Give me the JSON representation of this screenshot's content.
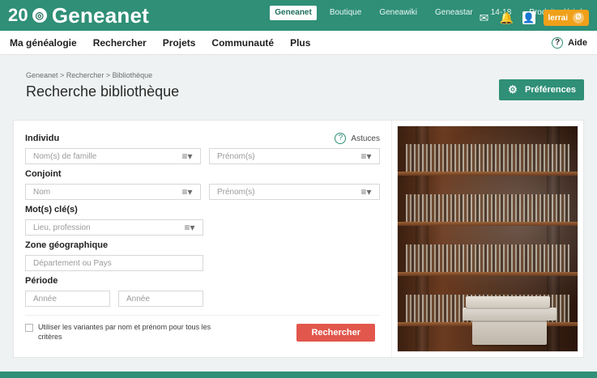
{
  "top": {
    "brand": {
      "prefix": "20",
      "name": "Geneanet"
    },
    "links": [
      {
        "label": "Geneanet",
        "active": true
      },
      {
        "label": "Boutique",
        "active": false
      },
      {
        "label": "Geneawiki",
        "active": false
      },
      {
        "label": "Geneastar",
        "active": false
      },
      {
        "label": "14-18",
        "active": false
      },
      {
        "label": "Produits dérivés",
        "active": false
      }
    ],
    "user": {
      "name": "lerrai",
      "badge": "Ø"
    }
  },
  "nav": {
    "items": [
      "Ma généalogie",
      "Rechercher",
      "Projets",
      "Communauté",
      "Plus"
    ],
    "help_label": "Aide"
  },
  "page": {
    "breadcrumb": "Geneanet > Rechercher > Bibliothèque",
    "title": "Recherche bibliothèque",
    "preferences_label": "Préférences"
  },
  "form": {
    "individu": {
      "label": "Individu",
      "astuces_label": "Astuces",
      "nom_placeholder": "Nom(s) de famille",
      "prenom_placeholder": "Prénom(s)"
    },
    "conjoint": {
      "label": "Conjoint",
      "nom_placeholder": "Nom",
      "prenom_placeholder": "Prénom(s)"
    },
    "mots_cles": {
      "label": "Mot(s) clé(s)",
      "placeholder": "Lieu, profession"
    },
    "zone": {
      "label": "Zone géographique",
      "placeholder": "Département ou Pays"
    },
    "periode": {
      "label": "Période",
      "annee1_placeholder": "Année",
      "annee2_placeholder": "Année"
    },
    "checkbox_label": "Utiliser les variantes par nom et prénom pour tous les critères",
    "search_button": "Rechercher"
  },
  "colors": {
    "brand": "#2f8f77",
    "danger": "#e2574c",
    "orange": "#f0a019"
  },
  "icons": {
    "menu": "menu-icon",
    "help": "help-icon",
    "gear": "gear-icon",
    "mail": "mail-icon",
    "bell": "bell-icon",
    "user": "user-icon"
  }
}
